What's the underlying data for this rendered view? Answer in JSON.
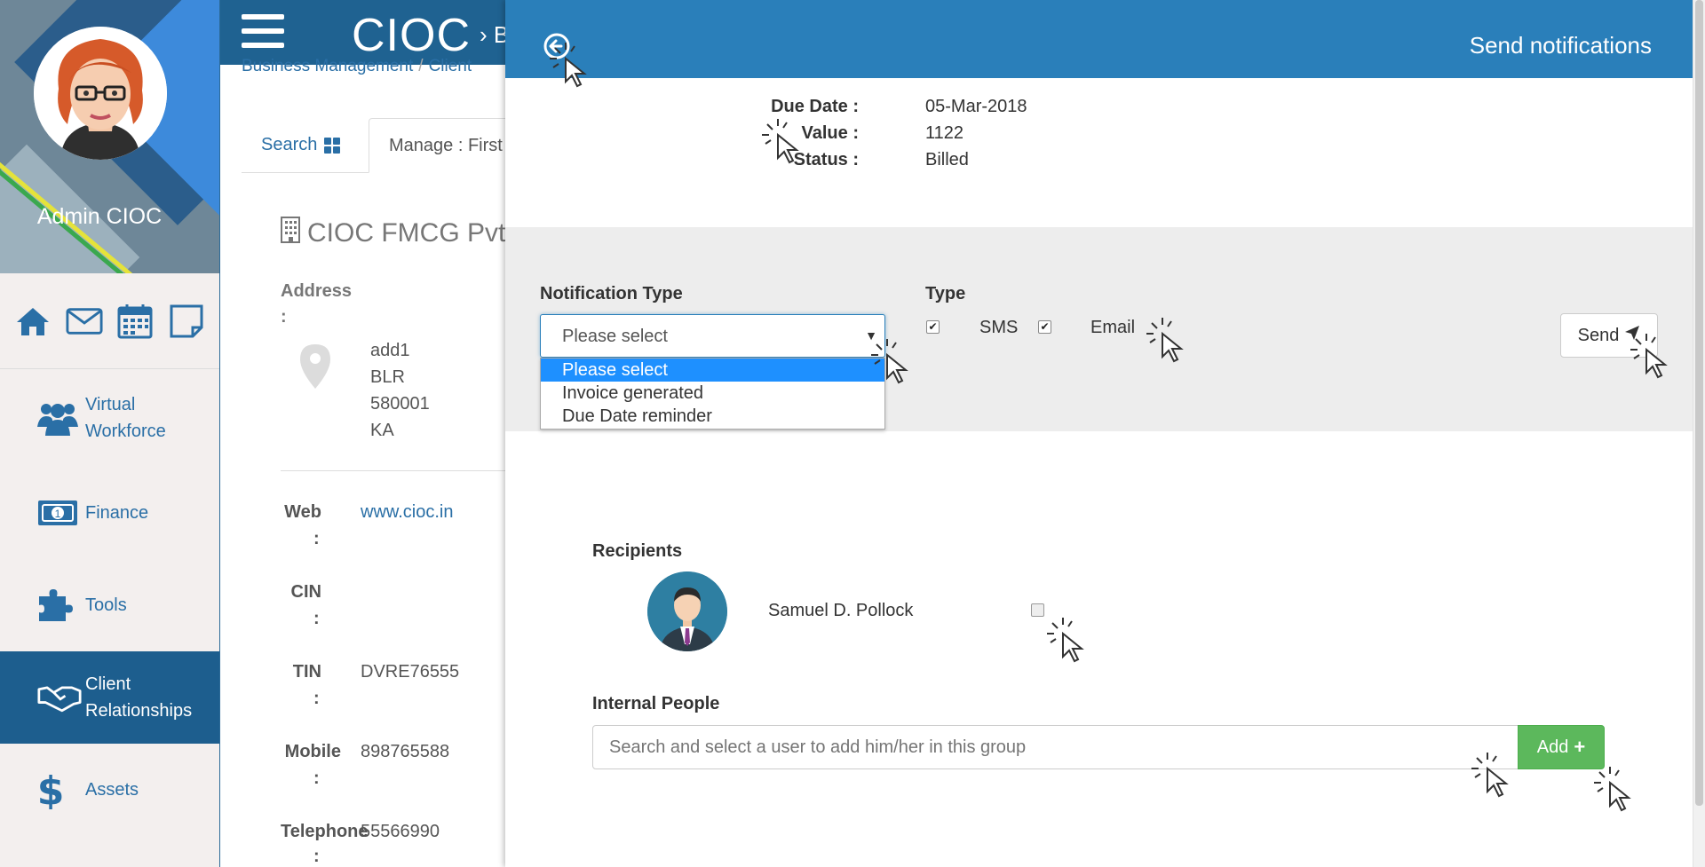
{
  "sidebar": {
    "user_name": "Admin CIOC",
    "quick_icons": [
      "home-icon",
      "mail-icon",
      "calendar-icon",
      "note-icon"
    ],
    "items": [
      {
        "label_1": "Virtual",
        "label_2": "Workforce",
        "icon": "users-icon"
      },
      {
        "label_1": "Finance",
        "icon": "money-icon"
      },
      {
        "label_1": "Tools",
        "icon": "puzzle-icon"
      },
      {
        "label_1": "Client",
        "label_2": "Relationships",
        "icon": "handshake-icon",
        "active": true
      },
      {
        "label_1": "Assets",
        "icon": "dollar-icon"
      }
    ]
  },
  "header": {
    "app_title": "CIOC",
    "title_rest": "› B"
  },
  "breadcrumb": {
    "item_1": "Business Management",
    "item_2": "Client"
  },
  "tabs": {
    "search_label": "Search",
    "manage_label": "Manage : First"
  },
  "company": {
    "name": "CIOC FMCG Pvt",
    "address_label": "Address",
    "address_lines": [
      "add1",
      "BLR",
      "580001",
      "KA"
    ],
    "web_label": "Web",
    "web_value": "www.cioc.in",
    "cin_label": "CIN",
    "tin_label": "TIN",
    "tin_value": "DVRE76555",
    "mobile_label": "Mobile",
    "mobile_value": "898765588",
    "telephone_label": "Telephone",
    "telephone_value": "55566990",
    "colon": ":"
  },
  "panel": {
    "title": "Send notifications",
    "due_date_label": "Due Date :",
    "due_date_value": "05-Mar-2018",
    "value_label": "Value :",
    "value_value": "1122",
    "status_label": "Status :",
    "status_value": "Billed",
    "notification_type_label": "Notification Type",
    "select_value": "Please select",
    "options": [
      "Please select",
      "Invoice generated",
      "Due Date reminder"
    ],
    "type_label": "Type",
    "sms_label": "SMS",
    "email_label": "Email",
    "sms_checked": true,
    "email_checked": true,
    "send_label": "Send",
    "recipients_label": "Recipients",
    "recipient_name": "Samuel D. Pollock",
    "internal_label": "Internal People",
    "internal_placeholder": "Search and select a user to add him/her in this group",
    "add_label": "Add"
  },
  "colors": {
    "header_blue": "#2a7fba",
    "nav_active": "#1d5e8e",
    "link_blue": "#2a6fa6",
    "select_highlight": "#1e90ff",
    "add_green": "#5cb85c"
  }
}
